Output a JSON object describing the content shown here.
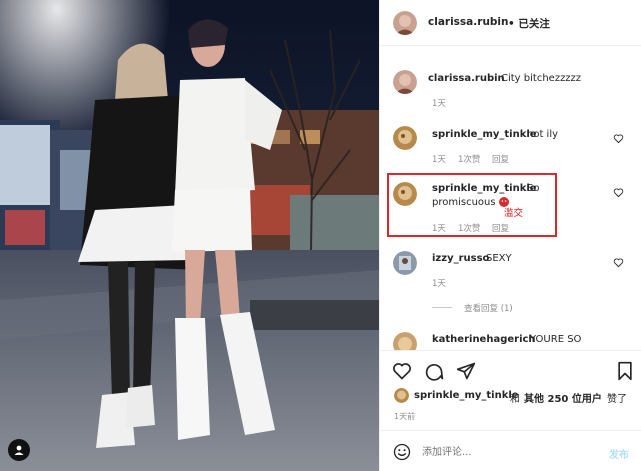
{
  "header": {
    "username": "clarissa.rubin",
    "follow_status": "• 已关注"
  },
  "caption": {
    "username": "clarissa.rubin",
    "text": "City bitchezzzzz",
    "time": "1天"
  },
  "comments": [
    {
      "username": "sprinkle_my_tinkle",
      "text": "hot ily",
      "time": "1天",
      "likes": "1次赞",
      "reply": "回复"
    },
    {
      "username": "sprinkle_my_tinkle",
      "text_line1": "So",
      "text_line2": "promiscuous",
      "time": "1天",
      "likes": "1次赞",
      "reply": "回复",
      "annotation": "滥交"
    },
    {
      "username": "izzy_russo",
      "text": "SEXY",
      "time": "1天",
      "view_replies": "查看回复 (1)"
    },
    {
      "username": "katherinehagerich",
      "text": "YOURE SO"
    }
  ],
  "likes": {
    "user": "sprinkle_my_tinkle",
    "and": "和",
    "others": "其他 250 位用户",
    "suffix": "赞了"
  },
  "post_time": "1天前",
  "comment_input": {
    "placeholder": "添加评论...",
    "post_label": "发布"
  },
  "colors": {
    "text": "#262626",
    "secondary": "#8e8e8e",
    "link": "#0095f6",
    "highlight": "#d92b2b"
  },
  "icons": [
    "emoji-icon",
    "heart-icon",
    "comment-icon",
    "share-icon",
    "bookmark-icon",
    "user-tag-icon"
  ]
}
